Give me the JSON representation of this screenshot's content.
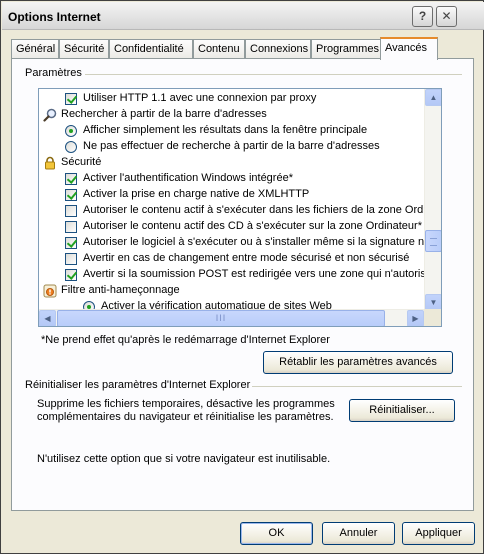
{
  "window": {
    "title": "Options Internet",
    "help_label": "?",
    "close_label": "✕"
  },
  "tabs": [
    {
      "label": "Général"
    },
    {
      "label": "Sécurité"
    },
    {
      "label": "Confidentialité"
    },
    {
      "label": "Contenu"
    },
    {
      "label": "Connexions"
    },
    {
      "label": "Programmes"
    },
    {
      "label": "Avancés",
      "active": true
    }
  ],
  "settings": {
    "label": "Paramètres",
    "items": [
      {
        "type": "checkbox",
        "checked": true,
        "label": "Utiliser HTTP 1.1 avec une connexion par proxy"
      },
      {
        "type": "category",
        "icon": "magnifier-icon",
        "label": "Rechercher à partir de la barre d'adresses"
      },
      {
        "type": "radio",
        "checked": true,
        "label": "Afficher simplement les résultats dans la fenêtre principale"
      },
      {
        "type": "radio",
        "checked": false,
        "label": "Ne pas effectuer de recherche à partir de la barre d'adresses"
      },
      {
        "type": "category",
        "icon": "lock-icon",
        "label": "Sécurité"
      },
      {
        "type": "checkbox",
        "checked": true,
        "label": "Activer l'authentification Windows intégrée*"
      },
      {
        "type": "checkbox",
        "checked": true,
        "label": "Activer la prise en charge native de XMLHTTP"
      },
      {
        "type": "checkbox",
        "checked": false,
        "label": "Autoriser le contenu actif à s'exécuter dans les fichiers de la zone Ordinate"
      },
      {
        "type": "checkbox",
        "checked": false,
        "label": "Autoriser le contenu actif des CD à s'exécuter sur la zone Ordinateur*"
      },
      {
        "type": "checkbox",
        "checked": true,
        "label": "Autoriser le logiciel à s'exécuter ou à s'installer même si la signature n'est p"
      },
      {
        "type": "checkbox",
        "checked": false,
        "label": "Avertir en cas de changement entre mode sécurisé et non sécurisé"
      },
      {
        "type": "checkbox",
        "checked": true,
        "label": "Avertir si la soumission POST est redirigée vers une zone qui n'autorise pas"
      },
      {
        "type": "category",
        "icon": "phishing-filter-icon",
        "label": "Filtre anti-hameçonnage"
      },
      {
        "type": "radio",
        "checked": true,
        "label": "Activer la vérification automatique de sites Web"
      }
    ],
    "scroll_thumb_grip": "III",
    "note": "*Ne prend effet qu'après le redémarrage d'Internet Explorer",
    "restore_button": "Rétablir les paramètres avancés"
  },
  "reset": {
    "label": "Réinitialiser les paramètres d'Internet Explorer",
    "description_line1": "Supprime les fichiers temporaires, désactive les programmes",
    "description_line2": "complémentaires du navigateur et réinitialise les paramètres.",
    "button": "Réinitialiser...",
    "warning": "N'utilisez cette option que si votre navigateur est inutilisable."
  },
  "footer": {
    "ok": "OK",
    "cancel": "Annuler",
    "apply": "Appliquer"
  },
  "colors": {
    "dialog_bg": "#ece9d8",
    "panel_bg": "#fcfcfe",
    "active_tab_accent": "#e68b2c",
    "check_green": "#21a121",
    "list_border": "#7f9db9"
  }
}
